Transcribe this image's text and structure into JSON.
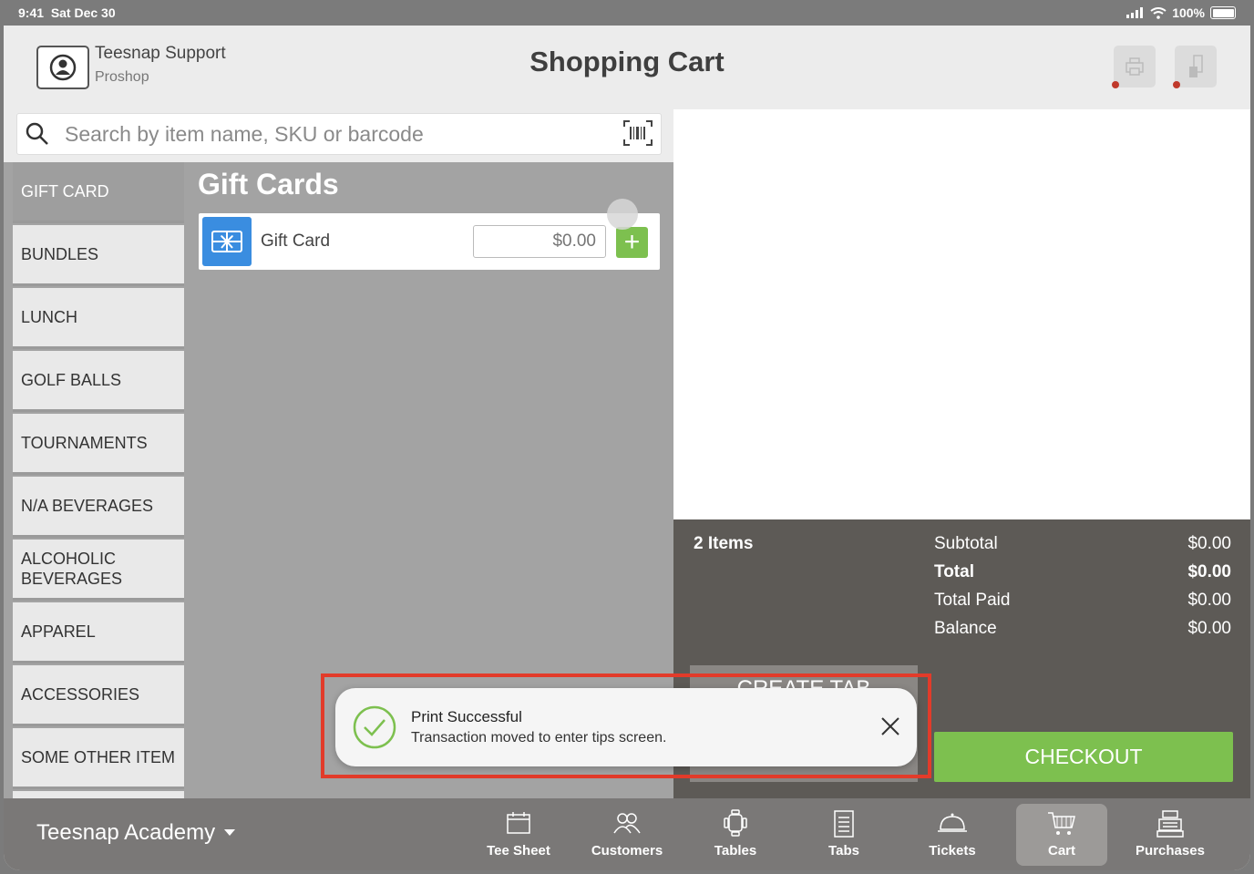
{
  "status_bar": {
    "time": "9:41",
    "date": "Sat Dec 30",
    "battery": "100%"
  },
  "header": {
    "user_name": "Teesnap Support",
    "user_role": "Proshop",
    "title": "Shopping Cart"
  },
  "search": {
    "placeholder": "Search by item name, SKU or barcode"
  },
  "categories": [
    {
      "label": "GIFT CARD",
      "active": true
    },
    {
      "label": "BUNDLES"
    },
    {
      "label": "LUNCH"
    },
    {
      "label": "GOLF BALLS"
    },
    {
      "label": "TOURNAMENTS"
    },
    {
      "label": "N/A BEVERAGES"
    },
    {
      "label": "ALCOHOLIC BEVERAGES"
    },
    {
      "label": "APPAREL"
    },
    {
      "label": "ACCESSORIES"
    },
    {
      "label": "SOME OTHER ITEM"
    }
  ],
  "products": {
    "section_title": "Gift Cards",
    "items": [
      {
        "name": "Gift Card",
        "price_placeholder": "$0.00"
      }
    ]
  },
  "totals": {
    "items_count": "2 Items",
    "rows": [
      {
        "label": "Subtotal",
        "value": "$0.00"
      },
      {
        "label": "Total",
        "value": "$0.00"
      },
      {
        "label": "Total Paid",
        "value": "$0.00"
      },
      {
        "label": "Balance",
        "value": "$0.00"
      }
    ],
    "create_tab_label": "CREATE TAB",
    "checkout_label": "CHECKOUT"
  },
  "toast": {
    "title": "Print Successful",
    "message": "Transaction moved to enter tips screen."
  },
  "tabbar": {
    "venue": "Teesnap Academy",
    "tabs": [
      {
        "label": "Tee Sheet",
        "icon": "calendar-icon"
      },
      {
        "label": "Customers",
        "icon": "customers-icon"
      },
      {
        "label": "Tables",
        "icon": "tables-icon"
      },
      {
        "label": "Tabs",
        "icon": "tabs-icon"
      },
      {
        "label": "Tickets",
        "icon": "cloche-icon"
      },
      {
        "label": "Cart",
        "icon": "cart-icon",
        "active": true
      },
      {
        "label": "Purchases",
        "icon": "register-icon"
      }
    ]
  },
  "colors": {
    "accent_green": "#7dc04f",
    "gift_blue": "#3a8de0",
    "highlight_red": "#e23b2a",
    "totals_bg": "#5d5a56"
  }
}
